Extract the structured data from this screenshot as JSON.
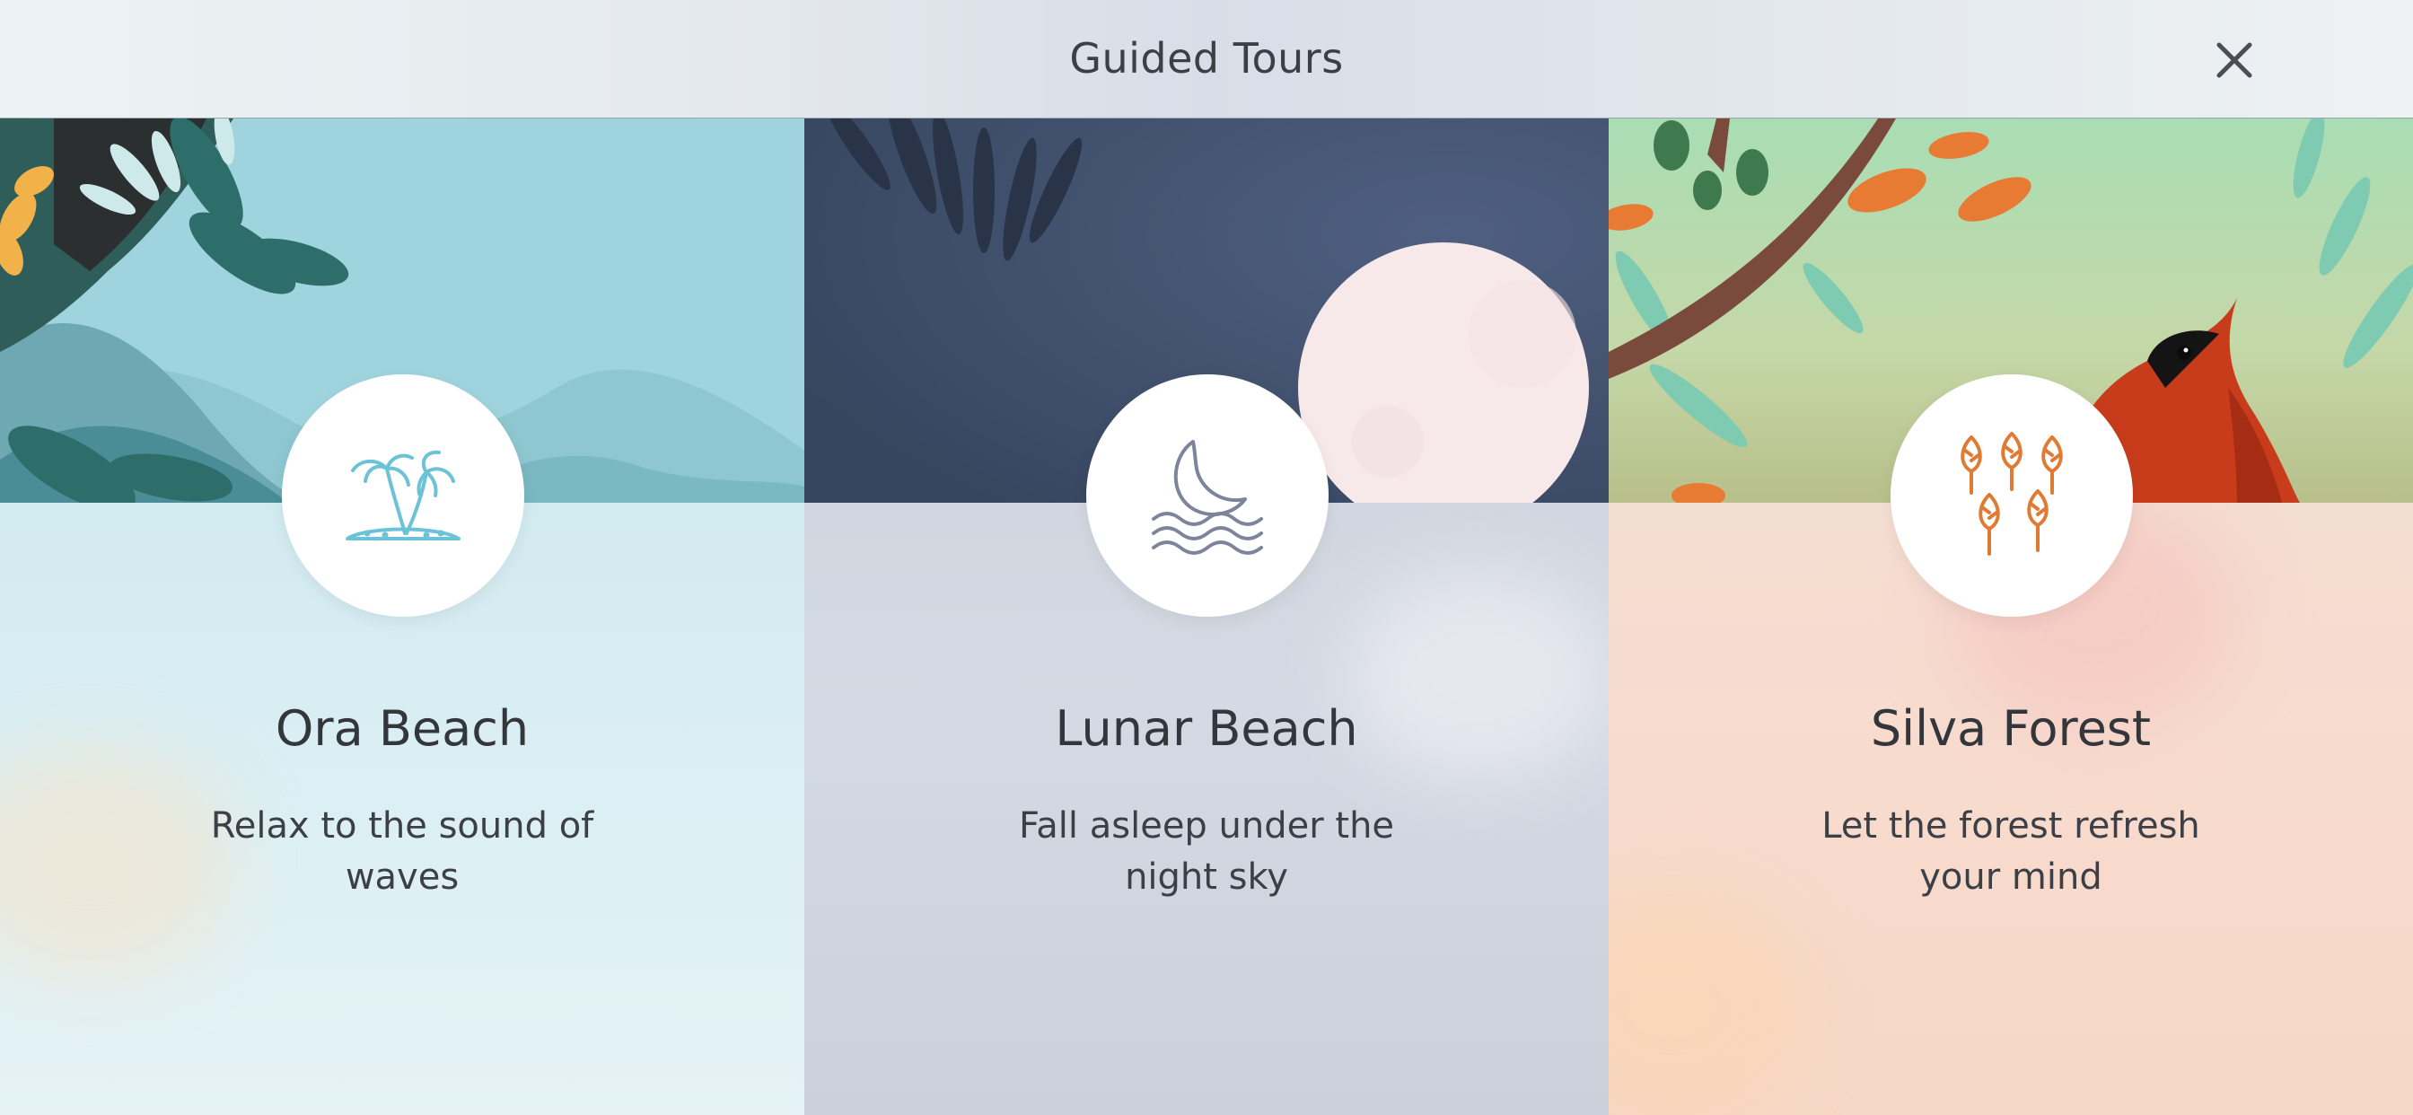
{
  "header": {
    "title": "Guided Tours",
    "close_icon": "close-icon"
  },
  "tours": [
    {
      "name": "Ora Beach",
      "description": "Relax to the sound of waves",
      "icon": "palm-island-icon",
      "accent": "#6cc3d8"
    },
    {
      "name": "Lunar Beach",
      "description": "Fall asleep under the night sky",
      "icon": "moon-waves-icon",
      "accent": "#7c859a"
    },
    {
      "name": "Silva Forest",
      "description": "Let the forest refresh your mind",
      "icon": "trees-icon",
      "accent": "#e07b33"
    }
  ]
}
